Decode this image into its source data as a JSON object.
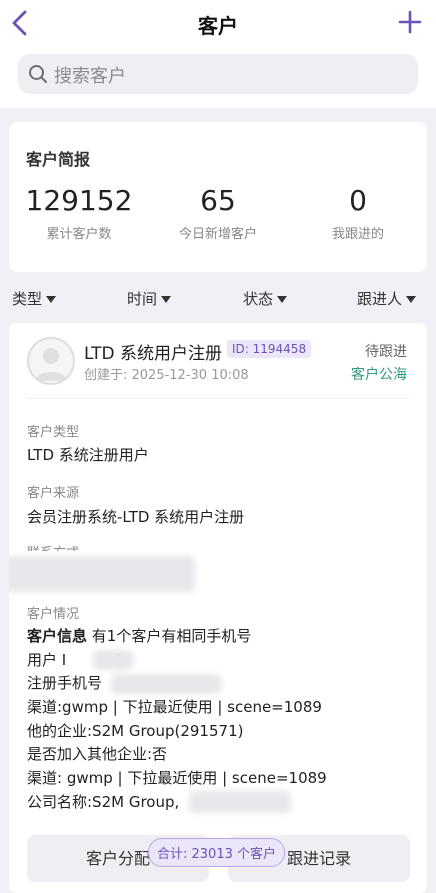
{
  "header": {
    "title": "客户",
    "back_icon": "chevron-left-icon",
    "add_icon": "plus-icon"
  },
  "search": {
    "placeholder": "搜索客户"
  },
  "summary": {
    "title": "客户简报",
    "stats": [
      {
        "value": "129152",
        "label": "累计客户数"
      },
      {
        "value": "65",
        "label": "今日新增客户"
      },
      {
        "value": "0",
        "label": "我跟进的"
      }
    ]
  },
  "filters": [
    {
      "label": "类型"
    },
    {
      "label": "时间"
    },
    {
      "label": "状态"
    },
    {
      "label": "跟进人"
    }
  ],
  "customer": {
    "name": "LTD 系统用户注册",
    "id_tag": "ID: 1194458",
    "created": "创建于: 2025-12-30 10:08",
    "status": "待跟进",
    "pool": "客户公海",
    "fields": {
      "type_label": "客户类型",
      "type_value": "LTD 系统注册用户",
      "source_label": "客户来源",
      "source_value": "会员注册系统-LTD 系统用户注册",
      "contact_label": "联系方式",
      "situation_label": "客户情况"
    },
    "situation": {
      "info_bold": "客户信息",
      "info_rest": " 有1个客户有相同手机号",
      "user_prefix": "用户 I",
      "user_suffix": "1",
      "phone_label": "注册手机号",
      "lines": [
        "渠道:gwmp | 下拉最近使用 | scene=1089",
        "他的企业:S2M Group(291571)",
        "是否加入其他企业:否",
        "渠道: gwmp | 下拉最近使用 | scene=1089"
      ],
      "company_prefix": "公司名称:S2M Group,"
    }
  },
  "actions": {
    "assign": "客户分配",
    "follow": "跟进记录"
  },
  "total": "合计: 23013 个客户",
  "colors": {
    "accent": "#6b52b8",
    "pool_green": "#2f9a7c"
  }
}
